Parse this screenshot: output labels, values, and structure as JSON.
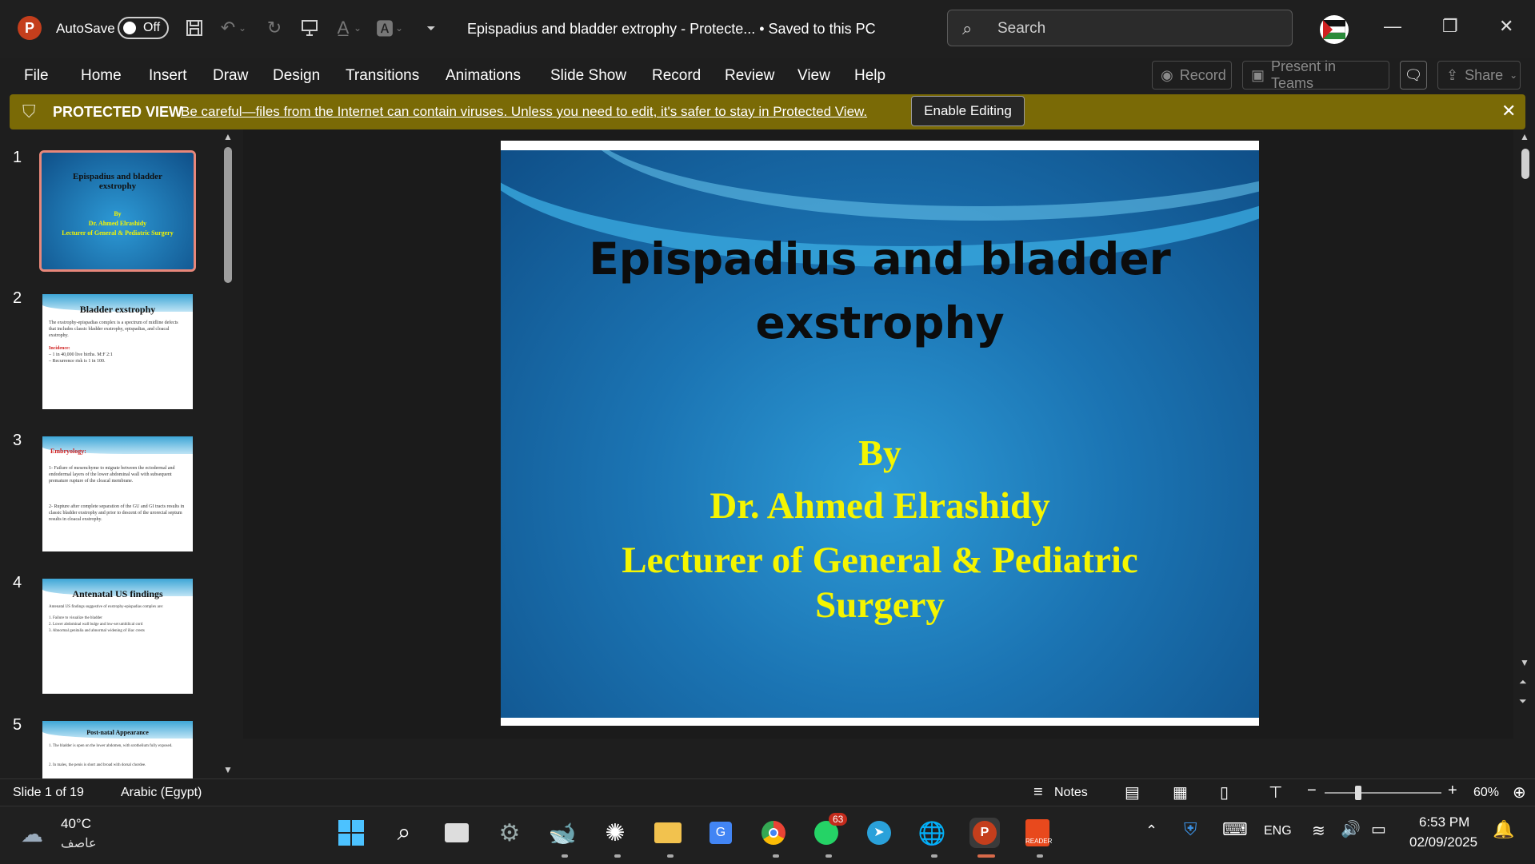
{
  "titlebar": {
    "app_logo": "P",
    "autosave_label": "AutoSave",
    "autosave_state": "Off",
    "doc_title": "Epispadius and bladder extrophy  -  Protecte...    •  Saved to this PC",
    "search_placeholder": "Search"
  },
  "menu": {
    "items": [
      "File",
      "Home",
      "Insert",
      "Draw",
      "Design",
      "Transitions",
      "Animations",
      "Slide Show",
      "Record",
      "Review",
      "View",
      "Help"
    ],
    "record_btn": "Record",
    "present_btn": "Present in Teams",
    "share_btn": "Share"
  },
  "protected_view": {
    "title": "PROTECTED VIEW",
    "message": "Be careful—files from the Internet can contain viruses. Unless you need to edit, it's safer to stay in Protected View.",
    "enable_button": "Enable Editing"
  },
  "thumbnails": [
    {
      "num": "1",
      "title": "Epispadius and bladder exstrophy",
      "lines": [
        "By",
        "Dr. Ahmed Elrashidy",
        "Lecturer of General & Pediatric Surgery"
      ]
    },
    {
      "num": "2",
      "title": "Bladder exstrophy",
      "lines": [
        "The exstrophy-epispadias complex is a spectrum of midline defects that includes classic bladder exstrophy, epispadias, and cloacal exstrophy.",
        "Incidence:",
        "– 1 in 40,000 live births. M:F 2:1",
        "– Recurrence risk is 1 in 100."
      ]
    },
    {
      "num": "3",
      "title": "Embryology:",
      "lines": [
        "1- Failure of mesenchyme to migrate between the ectodermal and endodermal layers of the lower abdominal wall with subsequent premature rupture of the cloacal membrane.",
        "2- Rupture after complete separation of the GU and GI tracts results in classic bladder exstrophy and prior to descent of the urorectal septum results in cloacal exstrophy."
      ]
    },
    {
      "num": "4",
      "title": "Antenatal US findings",
      "lines": [
        "Antenatal US findings suggestive of exstrophy-epispadias complex are:",
        "1. Failure to visualize the bladder",
        "2. Lower abdominal wall bulge and low-set umbilical cord",
        "3. Abnormal genitalia and abnormal widening of iliac crests"
      ]
    },
    {
      "num": "5",
      "title": "Post-natal Appearance",
      "lines": [
        "1. The bladder is open on the lower abdomen, with urothelium fully exposed.",
        "2. In males, the penis is short and broad with dorsal chordee."
      ]
    }
  ],
  "slide": {
    "title_line1": "Epispadius and bladder",
    "title_line2": "exstrophy",
    "by": "By",
    "author": "Dr. Ahmed Elrashidy",
    "role_line1": "Lecturer of General & Pediatric",
    "role_line2": "Surgery"
  },
  "status": {
    "slide_info": "Slide 1 of 19",
    "language": "Arabic (Egypt)",
    "notes": "Notes",
    "zoom": "60%"
  },
  "taskbar": {
    "weather_temp": "40°C",
    "weather_desc": "عاصف",
    "whatsapp_badge": "63",
    "lang": "ENG",
    "time": "6:53 PM",
    "date": "02/09/2025"
  }
}
